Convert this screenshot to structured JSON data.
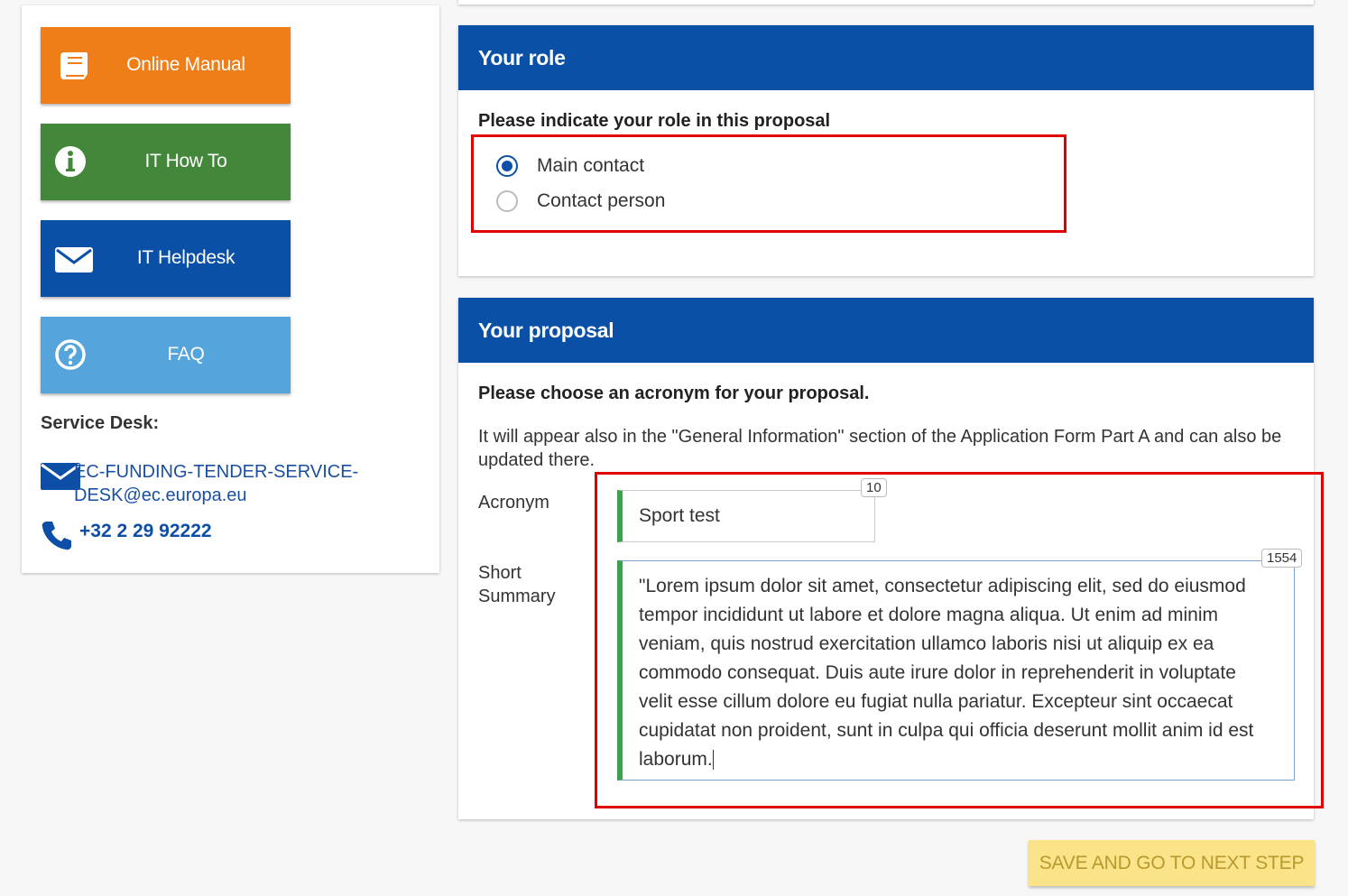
{
  "sidebar": {
    "buttons": [
      {
        "label": "Online Manual",
        "icon": "book-icon",
        "color": "#ef7d18"
      },
      {
        "label": "IT How To",
        "icon": "info-icon",
        "color": "#43873a"
      },
      {
        "label": "IT Helpdesk",
        "icon": "envelope-icon",
        "color": "#0a50a6"
      },
      {
        "label": "FAQ",
        "icon": "question-icon",
        "color": "#55a4dc"
      }
    ],
    "service_desk_label": "Service Desk:",
    "email": "EC-FUNDING-TENDER-SERVICE-DESK@ec.europa.eu",
    "phone": "+32 2 29 92222"
  },
  "role": {
    "title": "Your role",
    "question": "Please indicate your role in this proposal",
    "options": [
      {
        "label": "Main contact",
        "checked": true
      },
      {
        "label": "Contact person",
        "checked": false
      }
    ]
  },
  "proposal": {
    "title": "Your proposal",
    "question": "Please choose an acronym for your proposal.",
    "description": "It will appear also in the \"General Information\" section of the Application Form Part A and can also be updated there.",
    "acronym_label": "Acronym",
    "acronym_value": "Sport test",
    "acronym_counter": "10",
    "summary_label": "Short Summary",
    "summary_value": "\"Lorem ipsum dolor sit amet, consectetur adipiscing elit, sed do eiusmod tempor incididunt ut labore et dolore magna aliqua. Ut enim ad minim veniam, quis nostrud exercitation ullamco laboris nisi ut aliquip ex ea commodo consequat. Duis aute irure dolor in reprehenderit in voluptate velit esse cillum dolore eu fugiat nulla pariatur. Excepteur sint occaecat cupidatat non proident, sunt in culpa qui officia deserunt mollit anim id est laborum.",
    "summary_counter": "1554"
  },
  "actions": {
    "save_label": "SAVE AND GO TO NEXT STEP"
  },
  "colors": {
    "header_blue": "#0a50a6",
    "highlight_red": "#e00000",
    "valid_green": "#3aa34a",
    "save_yellow": "#fbe38a"
  }
}
